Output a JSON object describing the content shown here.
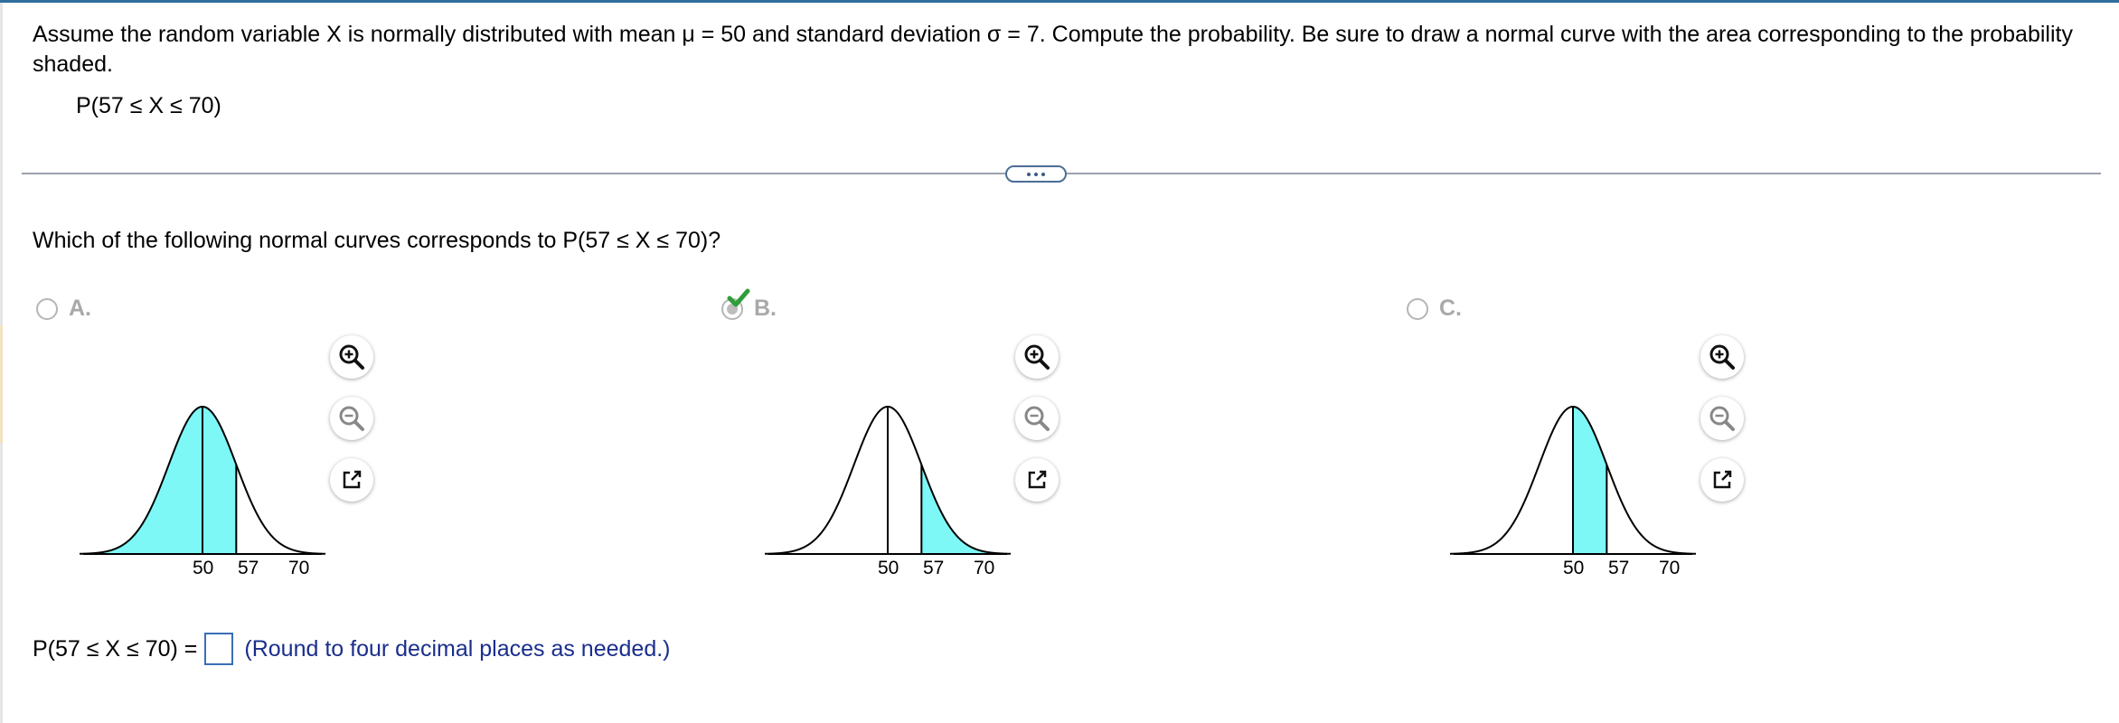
{
  "question": {
    "text": "Assume the random variable X is normally distributed with mean μ = 50 and standard deviation σ = 7. Compute the probability. Be sure to draw a normal curve with the area corresponding to the probability shaded.",
    "expression": "P(57 ≤ X ≤ 70)"
  },
  "divider": {
    "more_button_label": "more"
  },
  "part1": {
    "prompt": "Which of the following normal curves corresponds to P(57 ≤ X ≤ 70)?",
    "options": [
      {
        "letter": "A.",
        "selected": false,
        "shaded_region": "X ≤ 57",
        "tick_labels": [
          "50",
          "57",
          "70"
        ]
      },
      {
        "letter": "B.",
        "selected": true,
        "marked_correct": true,
        "shaded_region": "57 ≤ X ≤ 70",
        "tick_labels": [
          "50",
          "57",
          "70"
        ]
      },
      {
        "letter": "C.",
        "selected": false,
        "shaded_region": "50 ≤ X ≤ 57",
        "tick_labels": [
          "50",
          "57",
          "70"
        ]
      }
    ],
    "tools": [
      "zoom-in",
      "zoom-out",
      "open-in-new-window"
    ]
  },
  "part2": {
    "label": "P(57 ≤ X ≤ 70) =",
    "answer_value": "",
    "hint": "(Round to four decimal places as needed.)"
  },
  "colors": {
    "shade": "#7ef7f7",
    "hint_text": "#1a2e8c",
    "check": "#2f9e3a",
    "top_strip": "#2e6e9e"
  }
}
